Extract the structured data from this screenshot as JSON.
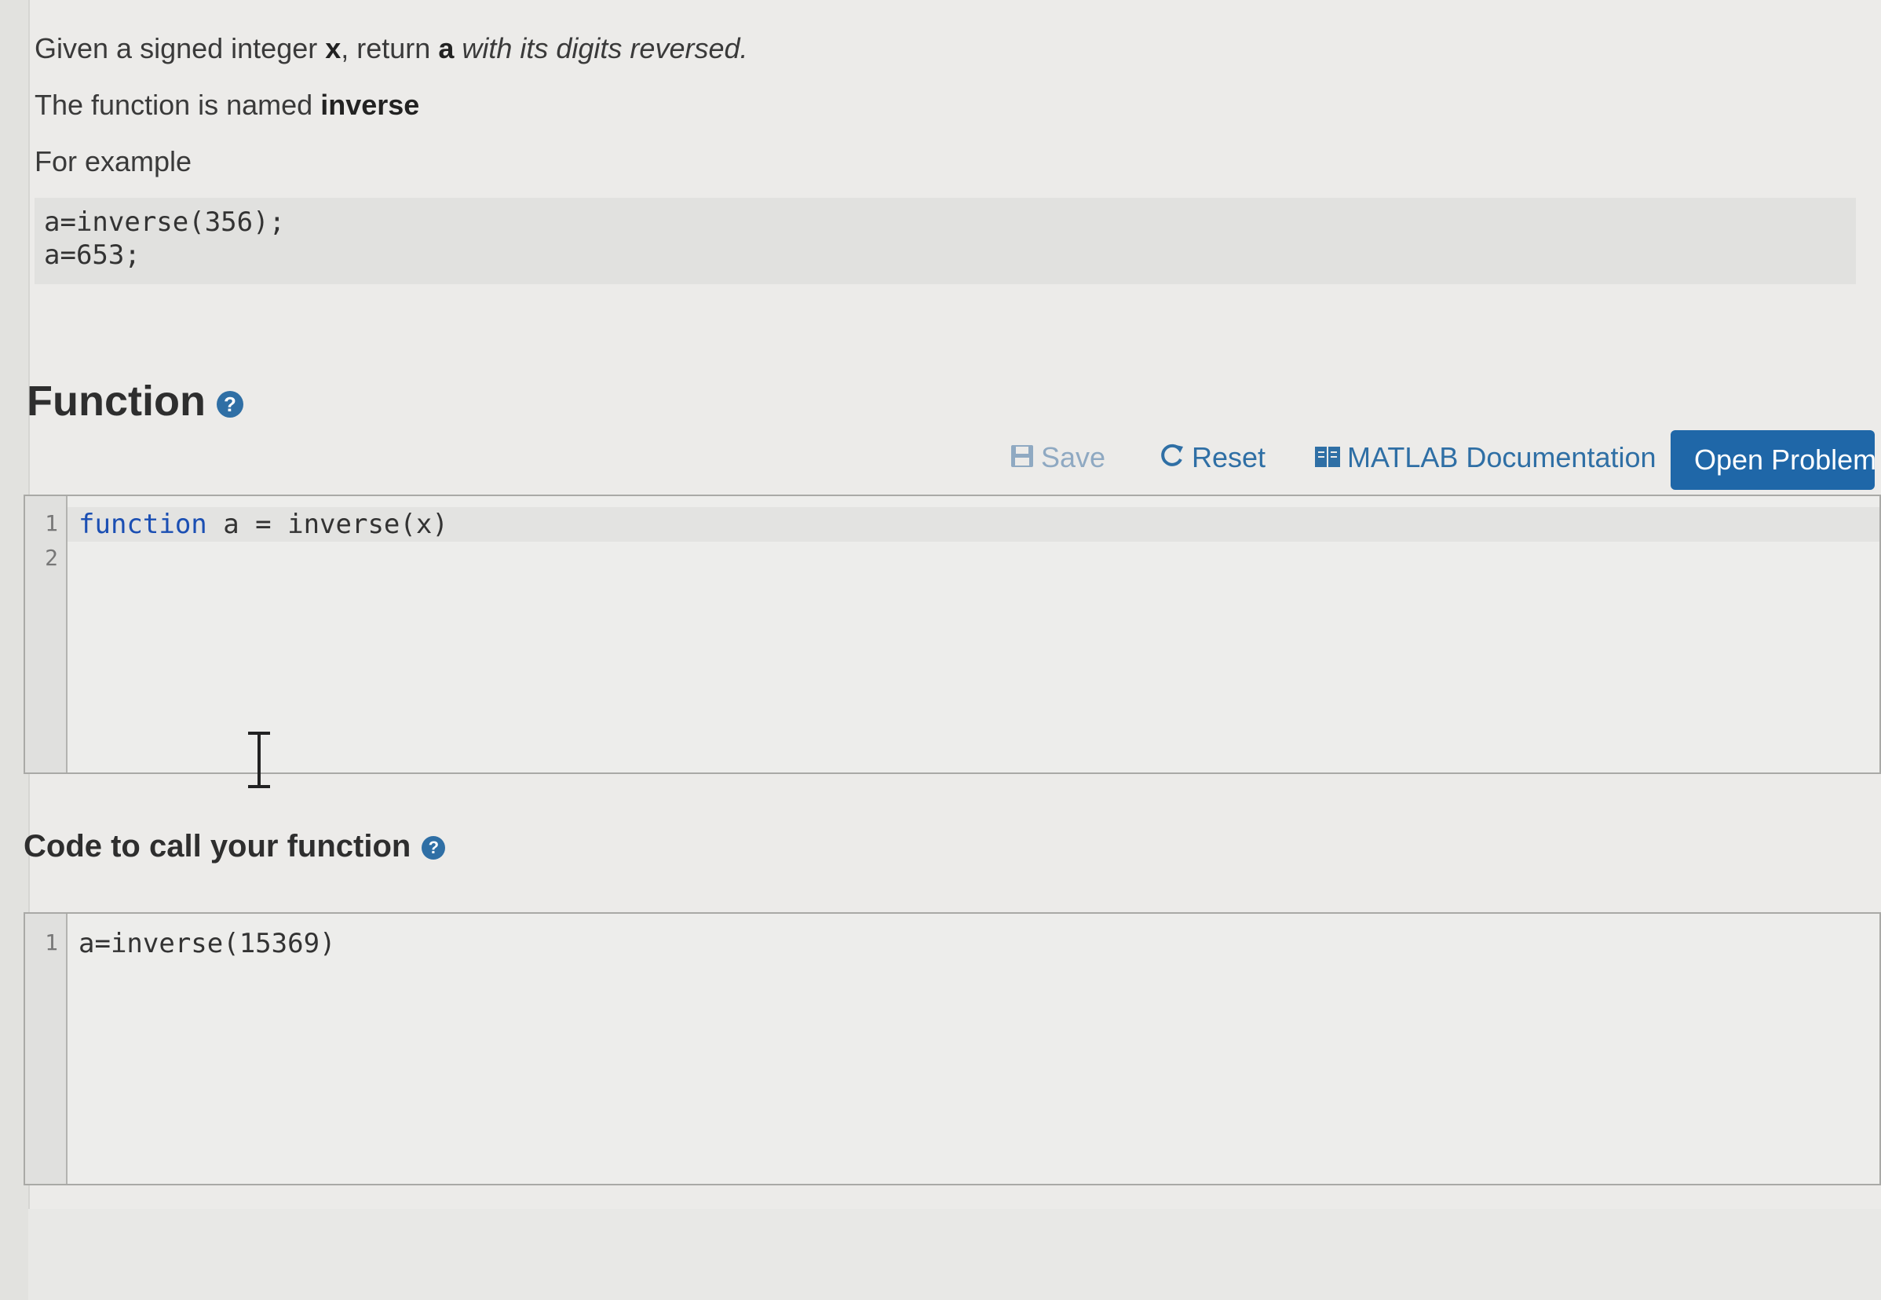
{
  "problem": {
    "line1_prefix": "Given a signed integer ",
    "line1_var": "x",
    "line1_mid": ", return ",
    "line1_ret": "a",
    "line1_suffix": " with its digits reversed.",
    "line2_prefix": "The function is named ",
    "line2_name": "inverse",
    "line3": "For example",
    "example_lines": [
      "a=inverse(356);",
      "a=653;"
    ]
  },
  "function_section": {
    "title": "Function",
    "help_icon": "question-circle-icon",
    "toolbar": {
      "save_label": "Save",
      "reset_label": "Reset",
      "doc_label": "MATLAB Documentation",
      "open_label": "Open Problem i"
    },
    "editor": {
      "line_numbers": [
        "1",
        "2"
      ],
      "keyword": "function",
      "code_rest": " a = inverse(x)"
    }
  },
  "call_section": {
    "title": "Code to call your function",
    "help_icon": "question-circle-icon",
    "editor": {
      "line_numbers": [
        "1"
      ],
      "code": "a=inverse(15369)"
    }
  },
  "colors": {
    "accent": "#1f67a8",
    "keyword": "#1b4fb3",
    "save_disabled": "#8fa9c2"
  }
}
